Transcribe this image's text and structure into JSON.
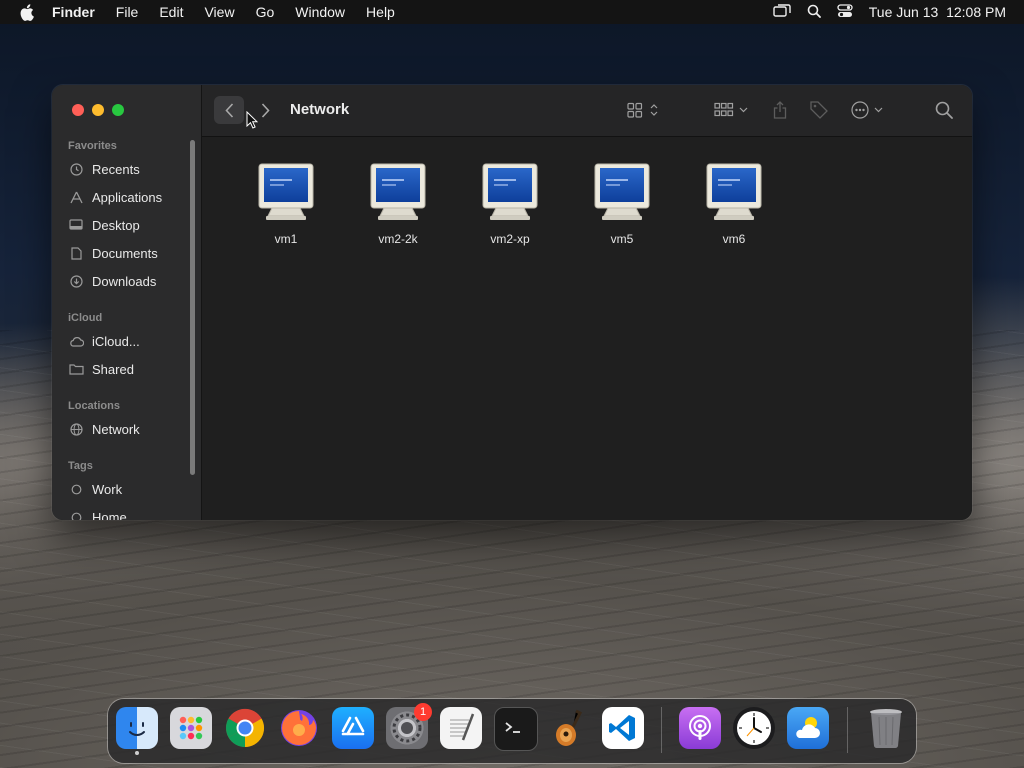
{
  "menubar": {
    "app_name": "Finder",
    "menus": [
      "File",
      "Edit",
      "View",
      "Go",
      "Window",
      "Help"
    ],
    "clock": "Tue Jun 13  12:08 PM",
    "status_icons": [
      "screen-mirroring-icon",
      "search-icon",
      "control-center-icon"
    ]
  },
  "window": {
    "title": "Network",
    "toolbar_icons": [
      "chevron-left-icon",
      "chevron-right-icon",
      "grid-view-icon",
      "group-icon",
      "share-icon",
      "tag-icon",
      "more-actions-icon",
      "search-icon"
    ]
  },
  "sidebar": {
    "sections": [
      {
        "title": "Favorites",
        "items": [
          {
            "label": "Recents",
            "icon": "clock-icon"
          },
          {
            "label": "Applications",
            "icon": "applications-icon"
          },
          {
            "label": "Desktop",
            "icon": "desktop-icon"
          },
          {
            "label": "Documents",
            "icon": "document-icon"
          },
          {
            "label": "Downloads",
            "icon": "download-icon"
          }
        ]
      },
      {
        "title": "iCloud",
        "items": [
          {
            "label": "iCloud...",
            "icon": "cloud-icon"
          },
          {
            "label": "Shared",
            "icon": "shared-folder-icon"
          }
        ]
      },
      {
        "title": "Locations",
        "items": [
          {
            "label": "Network",
            "icon": "globe-icon"
          }
        ]
      },
      {
        "title": "Tags",
        "items": [
          {
            "label": "Work",
            "icon": "tag-circle-icon"
          },
          {
            "label": "Home",
            "icon": "tag-circle-icon"
          }
        ]
      }
    ]
  },
  "files": [
    {
      "name": "vm1"
    },
    {
      "name": "vm2-2k"
    },
    {
      "name": "vm2-xp"
    },
    {
      "name": "vm5"
    },
    {
      "name": "vm6"
    }
  ],
  "dock": {
    "apps": [
      {
        "name": "finder-icon",
        "color": "#3b8ff0",
        "running": true
      },
      {
        "name": "launchpad-icon",
        "color": "#d8d8d8"
      },
      {
        "name": "chrome-icon",
        "color": "#ffffff"
      },
      {
        "name": "firefox-icon",
        "color": "#ff7139"
      },
      {
        "name": "app-store-icon",
        "color": "#1c8cf5"
      },
      {
        "name": "system-settings-icon",
        "color": "#8a8a8e",
        "badge": "1"
      },
      {
        "name": "textedit-icon",
        "color": "#f4f4f4"
      },
      {
        "name": "terminal-icon",
        "color": "#1a1a1a"
      },
      {
        "name": "garageband-icon",
        "color": "#e8a34a"
      },
      {
        "name": "vscode-icon",
        "color": "#ffffff"
      },
      {
        "name": "podcasts-icon",
        "color": "#b55ce6"
      },
      {
        "name": "clock-app-icon",
        "color": "#ffffff"
      },
      {
        "name": "weather-icon",
        "color": "#3b9cf0"
      },
      {
        "name": "trash-icon",
        "color": "#9a9a9a"
      }
    ]
  }
}
